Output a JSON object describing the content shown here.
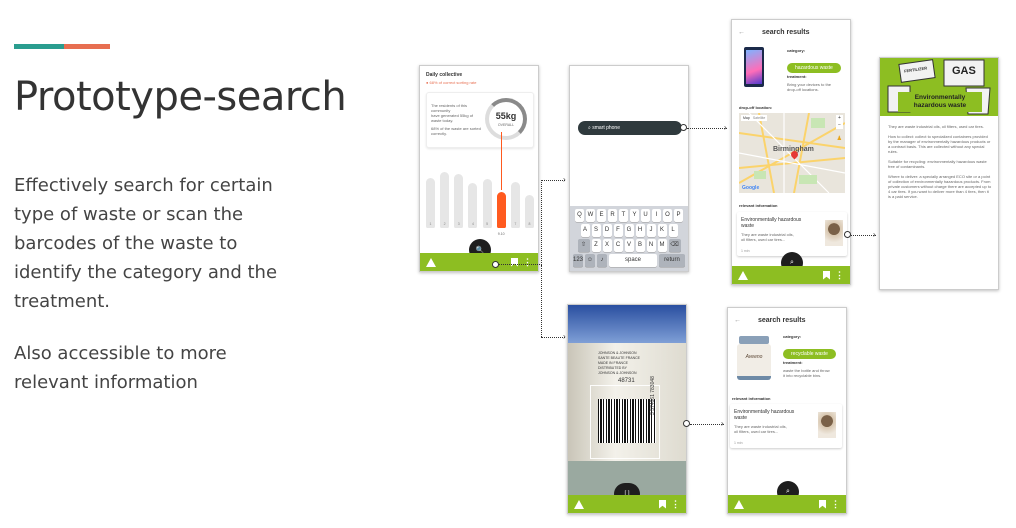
{
  "slide": {
    "title": "Prototype-search",
    "paragraph1": [
      "Effectively search for certain",
      "type of waste or scan the",
      "barcodes of the waste to",
      "identify the category and the",
      "treatment."
    ],
    "paragraph2": [
      "Also accessible to more",
      "relevant information"
    ],
    "accent_colors": [
      "#2a9d8f",
      "#e76f51"
    ]
  },
  "phone1": {
    "header": "Daily collective",
    "subheader": "68% of correct sorting rate",
    "card_text": [
      "The residents of this community",
      "have generated 55kg of waste today.",
      "68% of the waste are sorted correctly."
    ],
    "big_value": "55kg",
    "big_label": "OVERALL",
    "bar_heights": [
      0.7,
      0.78,
      0.75,
      0.62,
      0.68,
      0.5,
      0.64,
      0.46
    ],
    "highlight_index": 5,
    "bar_labels": [
      "1",
      "2",
      "3",
      "4",
      "5",
      "6",
      "7",
      "8"
    ],
    "highlight_label": "9.10",
    "search_glyph": "🔍"
  },
  "phone2": {
    "search_placeholder": "smart phone",
    "keyboard_rows": [
      [
        "Q",
        "W",
        "E",
        "R",
        "T",
        "Y",
        "U",
        "I",
        "O",
        "P"
      ],
      [
        "A",
        "S",
        "D",
        "F",
        "G",
        "H",
        "J",
        "K",
        "L"
      ],
      [
        "Z",
        "X",
        "C",
        "V",
        "B",
        "N",
        "M"
      ]
    ],
    "space_label": "space",
    "return_label": "return"
  },
  "phone3": {
    "title": "search results",
    "category_label": "category:",
    "category_value": "hazardous waste",
    "treatment_label": "treatment:",
    "treatment_text": [
      "Bring your devices to the",
      "drop-off locations."
    ],
    "dropoff_label": "drop-off location:",
    "map_city": "Birmingham",
    "map_tabs": [
      "Map",
      "Satellite"
    ],
    "map_brand": "Google",
    "relevant_label": "relevant information",
    "card_title": "Environmentally hazardous waste",
    "card_text": [
      "They are waste industrial oils,",
      "oil filters, used car tires..."
    ],
    "card_meta": "1 min"
  },
  "phone4": {
    "header": "Environmentally hazardous waste",
    "image_word": "GAS",
    "image_word2": "FERTILIZER",
    "paragraphs": [
      "They are waste industrial oils, oil filters, used car tires.",
      "How to collect: collect to specialized containers provided by the manager of environmentally hazardous products or a contract basis. This are collected without any special rules.",
      "Suitable for recycling: environmentally hazardous waste free of contaminants.",
      "Where to deliver: a specially arranged ECO site or a point of collection of environmentally hazardous products. From private customers without charge there are accepted up to 4 car tires. If you want to deliver more than 4 tires, then it is a paid service."
    ]
  },
  "phone5": {
    "label_lines": [
      "JOHNSON & JOHNSON",
      "SANTE BEAUTE FRANCE",
      "MADE IN FRANCE",
      "DISTRIBUTED BY",
      "JOHNSON & JOHNSON"
    ],
    "batch_number": "48731",
    "barcode_number": "3 574661 783048",
    "scan_glyph": "[ ]"
  },
  "phone6": {
    "title": "search results",
    "category_label": "category:",
    "category_value": "recyclable waste",
    "treatment_label": "treatment:",
    "treatment_text": [
      "waste the bottle and throw",
      "it into recyclable bins."
    ],
    "product_brand": "Aveeno",
    "relevant_label": "relevant information",
    "card_title": "Environmentally hazardous waste",
    "card_text": [
      "They are waste industrial oils,",
      "oil filters, used car tires..."
    ],
    "card_meta": "1 min"
  },
  "colors": {
    "green": "#8dbe22",
    "orange": "#ff5a1f",
    "dark": "#1e1e1e"
  }
}
